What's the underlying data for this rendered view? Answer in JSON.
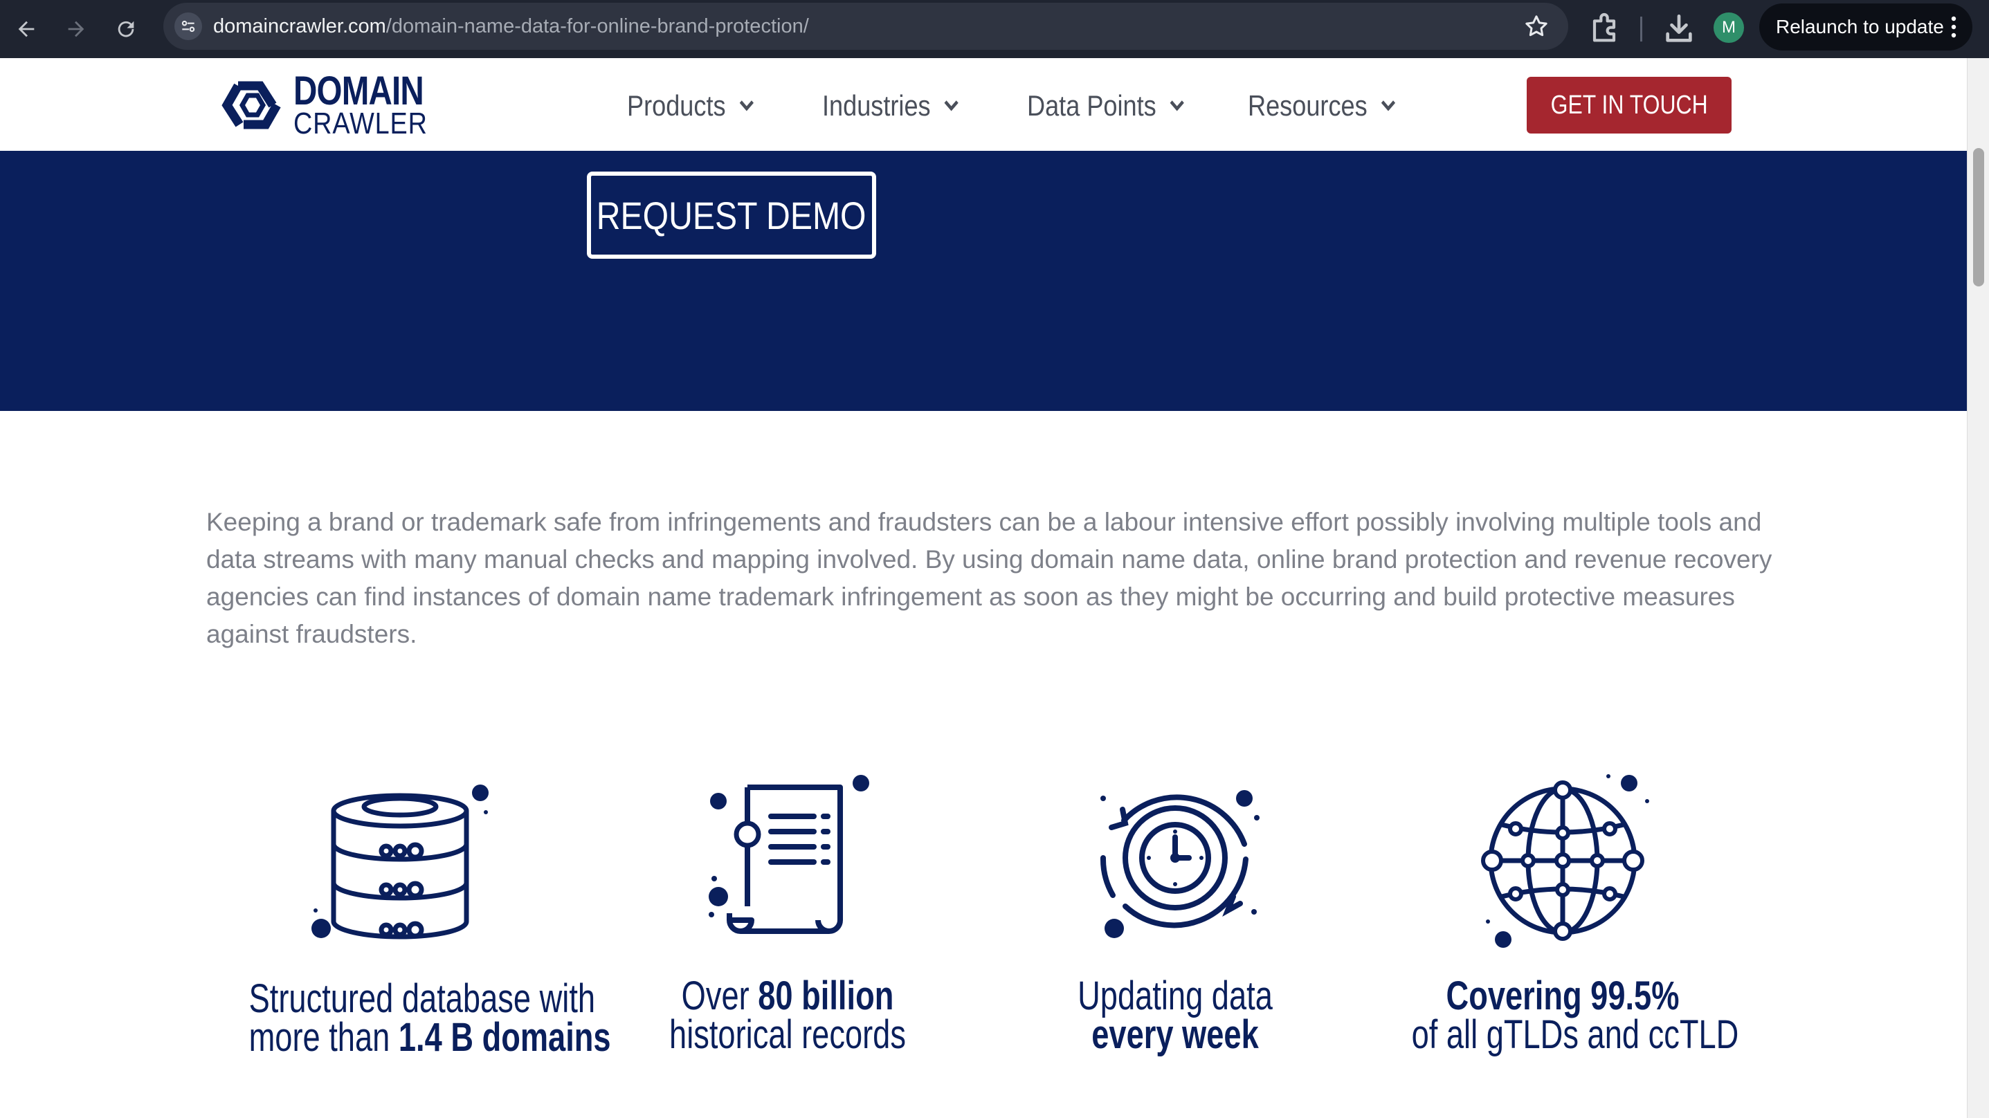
{
  "browser": {
    "url_host": "domaincrawler.com",
    "url_path": "/domain-name-data-for-online-brand-protection/",
    "profile_initial": "M",
    "relaunch_label": "Relaunch to update"
  },
  "header": {
    "logo_top": "DOMAIN",
    "logo_bottom": "CRAWLER",
    "nav": [
      {
        "label": "Products"
      },
      {
        "label": "Industries"
      },
      {
        "label": "Data Points"
      },
      {
        "label": "Resources"
      }
    ],
    "cta_label": "GET IN TOUCH"
  },
  "hero": {
    "demo_label": "REQUEST DEMO"
  },
  "intro": {
    "text": "Keeping a brand or trademark safe from infringements and fraudsters can be a labour intensive effort possibly involving multiple tools and data streams with many manual checks and mapping involved. By using domain name data, online brand protection and revenue recovery agencies can find instances of domain name trademark infringement as soon as they might be occurring and build protective measures against fraudsters."
  },
  "features": [
    {
      "icon": "database-icon",
      "line1": "Structured database with",
      "line2_pre": "more than ",
      "line2_bold": "1.4 B domains"
    },
    {
      "icon": "records-scroll-icon",
      "line1_pre": "Over ",
      "line1_bold": "80 billion",
      "line2": "historical records"
    },
    {
      "icon": "clock-refresh-icon",
      "line1": "Updating data",
      "line2_bold": "every week"
    },
    {
      "icon": "globe-network-icon",
      "line1_bold": "Covering 99.5%",
      "line2": "of all gTLDs and ccTLD"
    }
  ],
  "colors": {
    "brand_navy": "#0a1f5c",
    "cta_red": "#a5262f",
    "chrome_dark": "#1f2430",
    "body_text": "#7d8089"
  }
}
